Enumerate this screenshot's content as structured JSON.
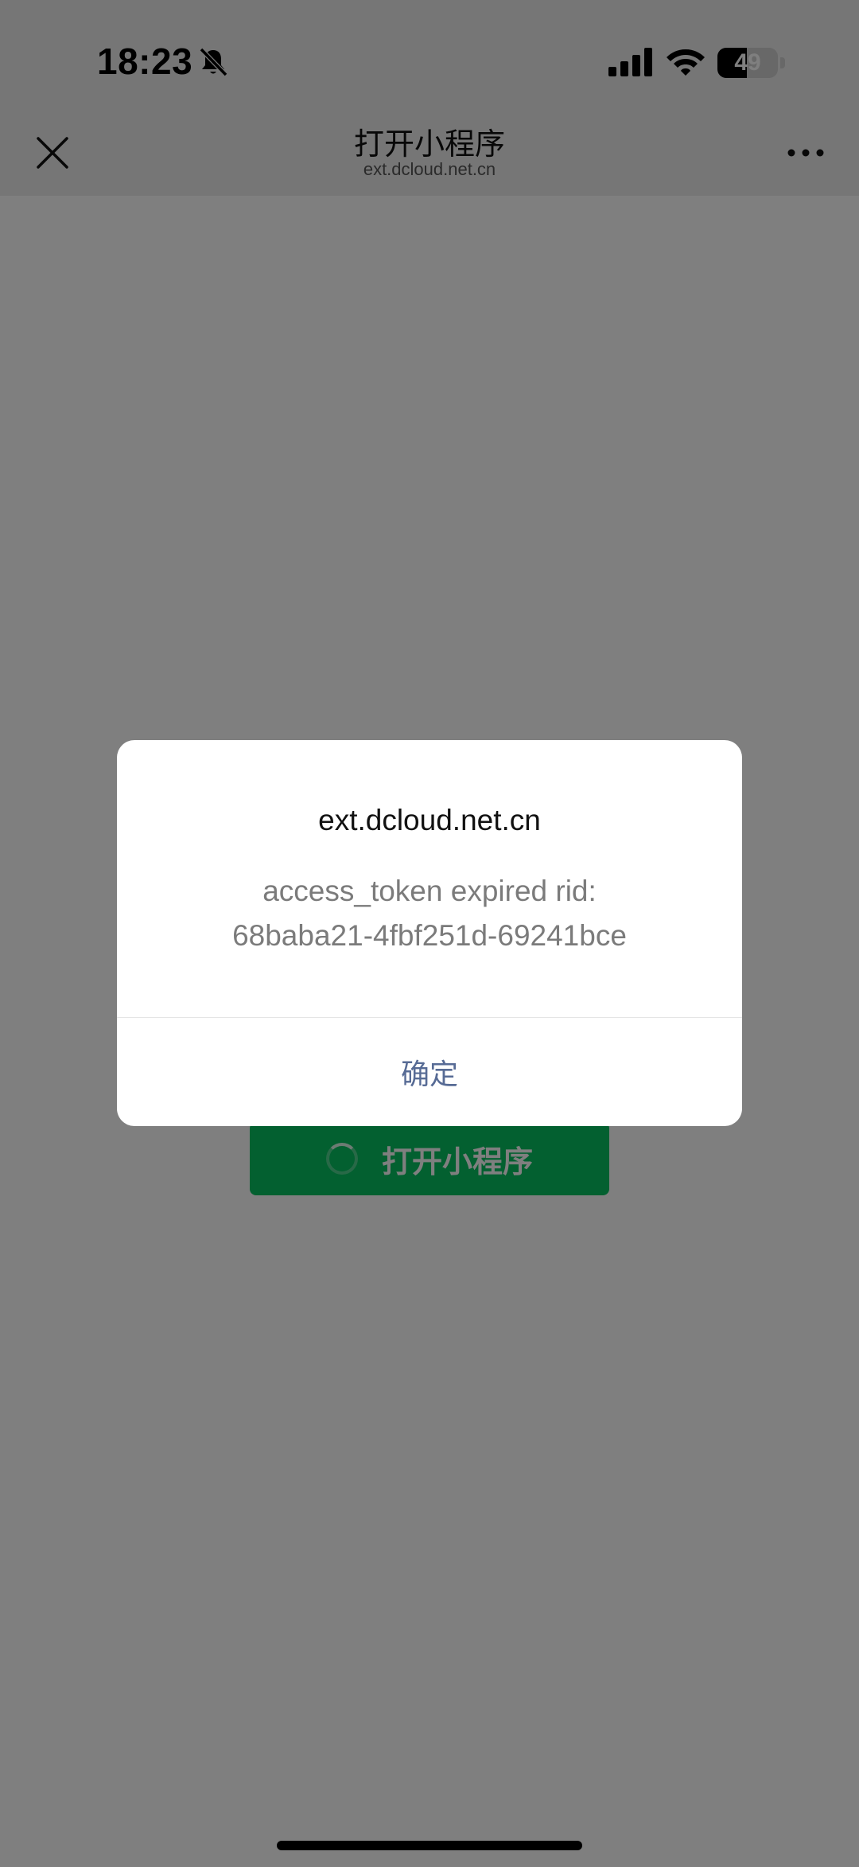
{
  "status_bar": {
    "time": "18:23",
    "battery_level": "49",
    "battery_fraction": 0.49,
    "icons": [
      "bell-slash-icon",
      "signal-icon",
      "wifi-icon",
      "battery-icon"
    ]
  },
  "nav": {
    "title": "打开小程序",
    "subtitle": "ext.dcloud.net.cn",
    "close_icon": "close-icon",
    "more_icon": "more-icon"
  },
  "page": {
    "open_button_label": "打开小程序",
    "accent_color": "#07c160"
  },
  "dialog": {
    "title": "ext.dcloud.net.cn",
    "message_line1": "access_token expired rid:",
    "message_line2": "68baba21-4fbf251d-69241bce",
    "confirm_label": "确定",
    "confirm_color": "#576b95"
  }
}
